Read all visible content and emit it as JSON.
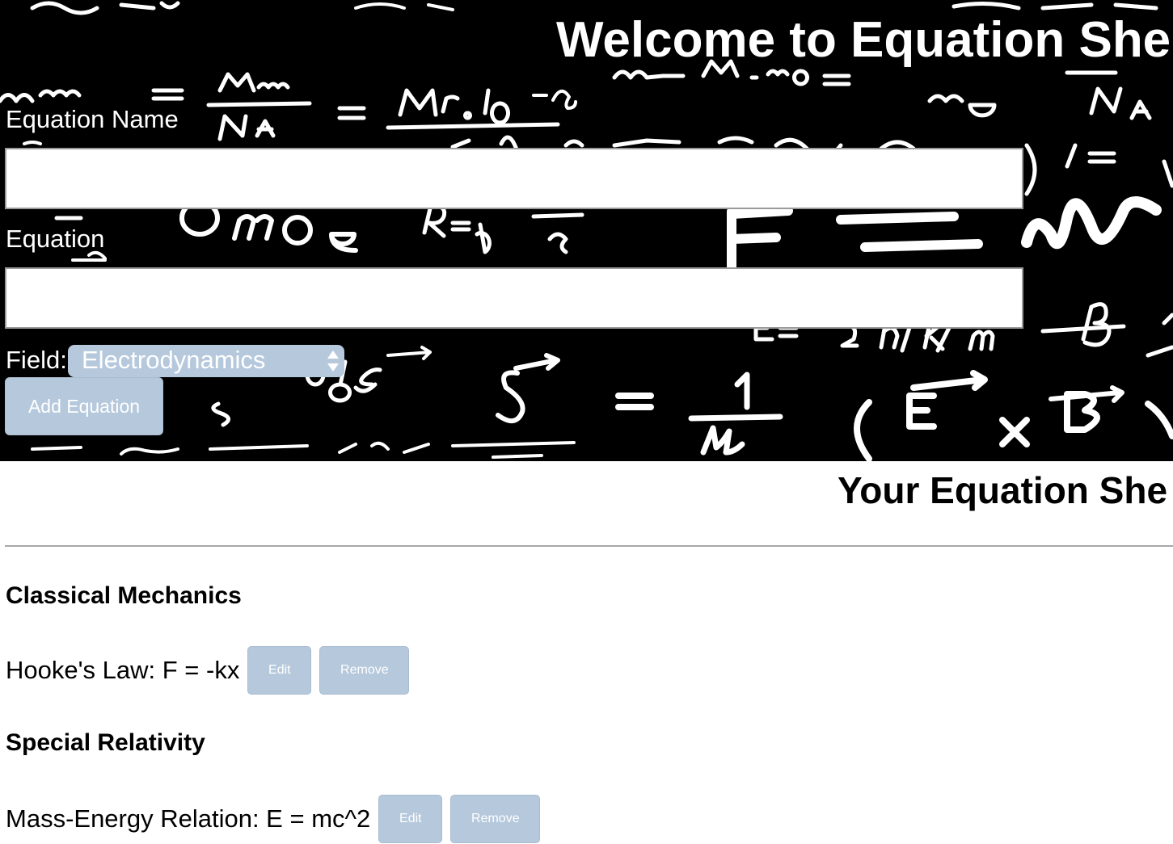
{
  "header": {
    "title": "Welcome to Equation She"
  },
  "form": {
    "name_label": "Equation Name",
    "name_value": "",
    "equation_label": "Equation",
    "equation_value": "",
    "field_label": "Field:",
    "field_selected": "Electrodynamics",
    "add_button": "Add Equation"
  },
  "sheet": {
    "title": "Your Equation She",
    "sections": [
      {
        "heading": "Classical Mechanics",
        "equations": [
          {
            "text": "Hooke's Law: F = -kx",
            "edit_label": "Edit",
            "remove_label": "Remove"
          }
        ]
      },
      {
        "heading": "Special Relativity",
        "equations": [
          {
            "text": "Mass-Energy Relation: E = mc^2",
            "edit_label": "Edit",
            "remove_label": "Remove"
          }
        ]
      }
    ]
  },
  "colors": {
    "button_bg": "#b5c8dc",
    "header_bg": "#000000",
    "chalk": "#ffffff"
  }
}
